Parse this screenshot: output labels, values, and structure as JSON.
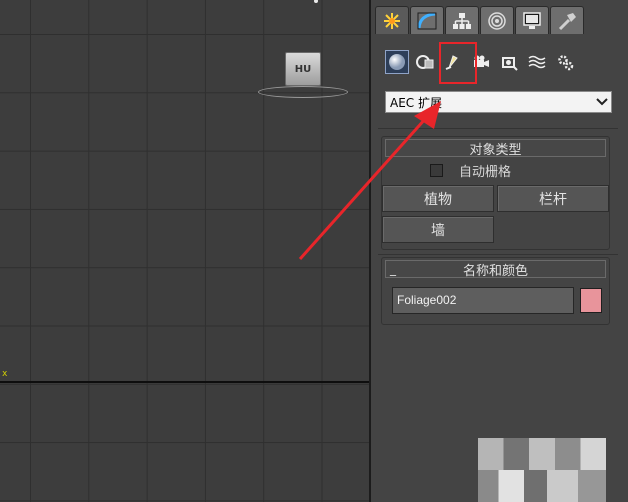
{
  "viewport": {
    "viewcube_label": "HU",
    "axis_label": "x"
  },
  "command_panel": {
    "tabs": [
      {
        "name": "create",
        "icon": "create-star-icon",
        "active": true
      },
      {
        "name": "modify",
        "icon": "modify-curve-icon",
        "active": false
      },
      {
        "name": "hierarchy",
        "icon": "hierarchy-icon",
        "active": false
      },
      {
        "name": "motion",
        "icon": "motion-icon",
        "active": false
      },
      {
        "name": "display",
        "icon": "display-monitor-icon",
        "active": false
      },
      {
        "name": "utilities",
        "icon": "utilities-hammer-icon",
        "active": false
      }
    ],
    "subcategories": [
      {
        "name": "geometry",
        "icon": "geometry-sphere-icon",
        "active": true
      },
      {
        "name": "shapes",
        "icon": "shapes-icon",
        "active": false
      },
      {
        "name": "lights",
        "icon": "light-icon",
        "active": false
      },
      {
        "name": "cameras",
        "icon": "camera-icon",
        "active": false
      },
      {
        "name": "helpers",
        "icon": "helper-icon",
        "active": false
      },
      {
        "name": "space-warps",
        "icon": "space-warp-icon",
        "active": false
      },
      {
        "name": "systems",
        "icon": "systems-gear-icon",
        "active": false
      }
    ],
    "category_dropdown": {
      "selected": "AEC 扩展"
    },
    "object_type": {
      "title": "对象类型",
      "autogrid_label": "自动栅格",
      "buttons": [
        "植物",
        "栏杆",
        "墙"
      ]
    },
    "name_and_color": {
      "collapse_symbol": "_",
      "title": "名称和颜色",
      "name_value": "Foliage002",
      "swatch_color": "#e8949b"
    }
  },
  "colors": {
    "highlight": "#e8252a",
    "annotation_arrow": "#e8252a"
  }
}
